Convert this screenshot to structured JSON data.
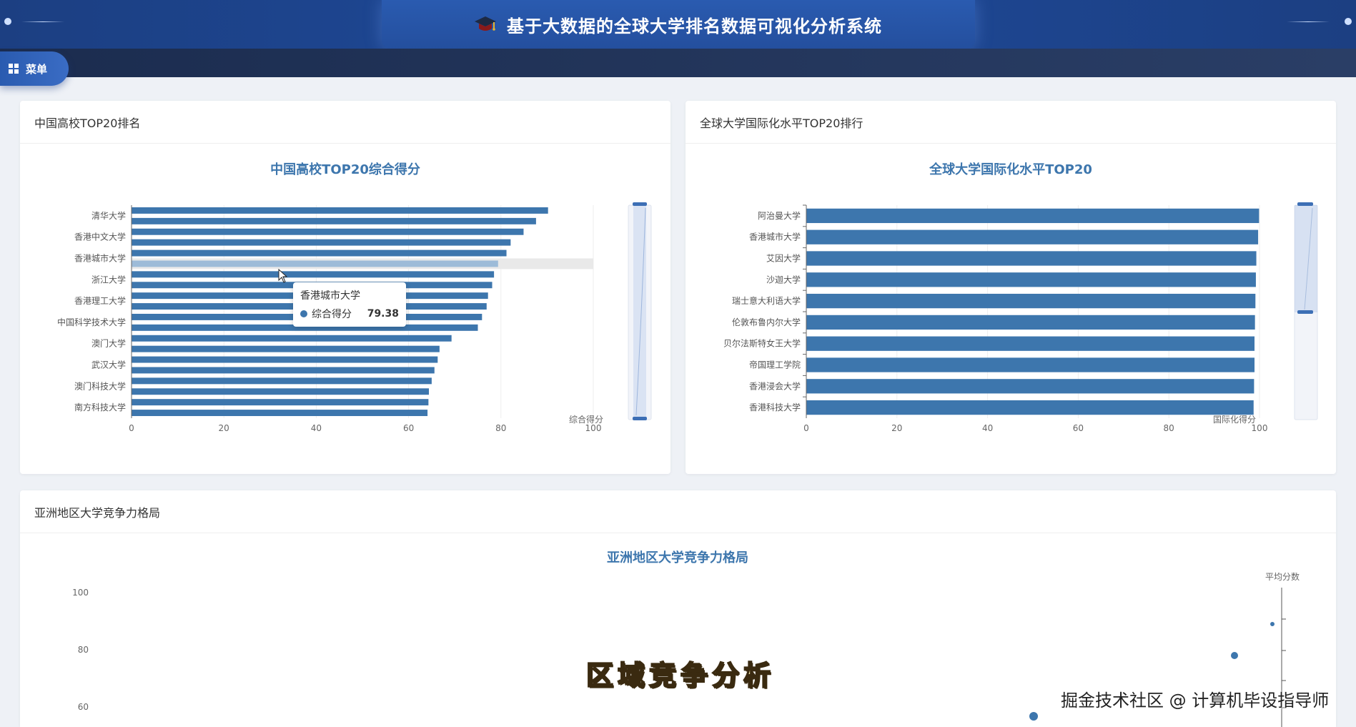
{
  "header": {
    "title": "基于大数据的全球大学排名数据可视化分析系统",
    "menu_label": "菜单"
  },
  "panels": {
    "china_top20": {
      "heading": "中国高校TOP20排名"
    },
    "intl_top20": {
      "heading": "全球大学国际化水平TOP20排行"
    },
    "asia": {
      "heading": "亚洲地区大学竞争力格局"
    }
  },
  "chart_data": [
    {
      "type": "bar",
      "title": "中国高校TOP20综合得分",
      "xlabel": "综合得分",
      "xlim": [
        0,
        100
      ],
      "xticks": [
        0,
        20,
        40,
        60,
        80,
        100
      ],
      "category_labels_shown": [
        "清华大学",
        "香港中文大学",
        "香港城市大学",
        "浙江大学",
        "香港理工大学",
        "中国科学技术大学",
        "澳门大学",
        "武汉大学",
        "澳门科技大学",
        "南方科技大学"
      ],
      "values": [
        90.2,
        87.6,
        84.9,
        82.1,
        81.2,
        79.38,
        78.5,
        78.1,
        77.2,
        76.9,
        75.9,
        75.0,
        69.3,
        66.7,
        66.3,
        65.6,
        65.0,
        64.4,
        64.3,
        64.1
      ],
      "highlight_index": 5,
      "tooltip": {
        "name": "香港城市大学",
        "series": "综合得分",
        "value": "79.38"
      },
      "color": "#3d76ad"
    },
    {
      "type": "bar",
      "title": "全球大学国际化水平TOP20",
      "xlabel": "国际化得分",
      "xlim": [
        0,
        100
      ],
      "xticks": [
        0,
        20,
        40,
        60,
        80,
        100
      ],
      "categories": [
        "阿治曼大学",
        "香港城市大学",
        "艾因大学",
        "沙迦大学",
        "瑞士意大利语大学",
        "伦敦布鲁内尔大学",
        "贝尔法斯特女王大学",
        "帝国理工学院",
        "香港浸会大学",
        "香港科技大学"
      ],
      "values": [
        99.9,
        99.7,
        99.3,
        99.2,
        99.1,
        99.0,
        98.9,
        98.9,
        98.8,
        98.7
      ],
      "color": "#3d76ad"
    },
    {
      "type": "scatter",
      "title": "亚洲地区大学竞争力格局",
      "ylabel": "",
      "yticks": [
        60,
        80,
        100
      ],
      "visual_map_label": "平均分数",
      "color": "#3d76ad"
    }
  ],
  "overlays": {
    "subtitle": "区域竞争分析",
    "watermark": "掘金技术社区 @ 计算机毕设指导师"
  }
}
